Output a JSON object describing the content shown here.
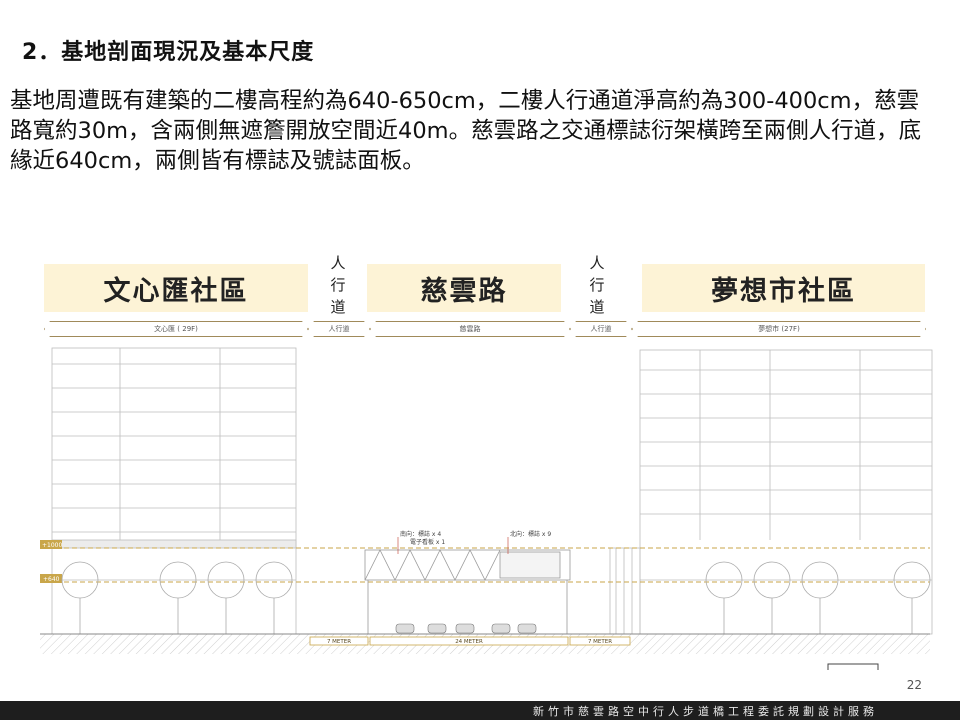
{
  "slide": {
    "title": "2．基地剖面現況及基本尺度",
    "body": "基地周遭既有建築的二樓高程約為640-650cm，二樓人行通道淨高約為300-400cm，慈雲路寬約30m，含兩側無遮簷開放空間近40m。慈雲路之交通標誌衍架橫跨至兩側人行道，底緣近640cm，兩側皆有標誌及號誌面板。",
    "page_number": "22",
    "footer": "新竹市慈雲路空中行人步道橋工程委託規劃設計服務"
  },
  "bands": {
    "left": "文心匯社區",
    "center": "慈雲路",
    "right": "夢想市社區",
    "walk_chars": [
      "人",
      "行",
      "道"
    ]
  },
  "dimension_labels": {
    "left_building": "文心匯 ( 29F)",
    "sidewalk": "人行道",
    "road": "慈雲路",
    "right_building": "夢想市 (27F)"
  },
  "section": {
    "level_upper": "+1000",
    "level_lower": "+640",
    "sign_note_left_1": "南向：標誌 x 4",
    "sign_note_left_2": "電子看板 x 1",
    "sign_note_right": "北向：標誌 x 9",
    "meter_left": "7 METER",
    "meter_center": "24 METER",
    "meter_right": "7 METER",
    "line_color": "#c9a64a"
  }
}
